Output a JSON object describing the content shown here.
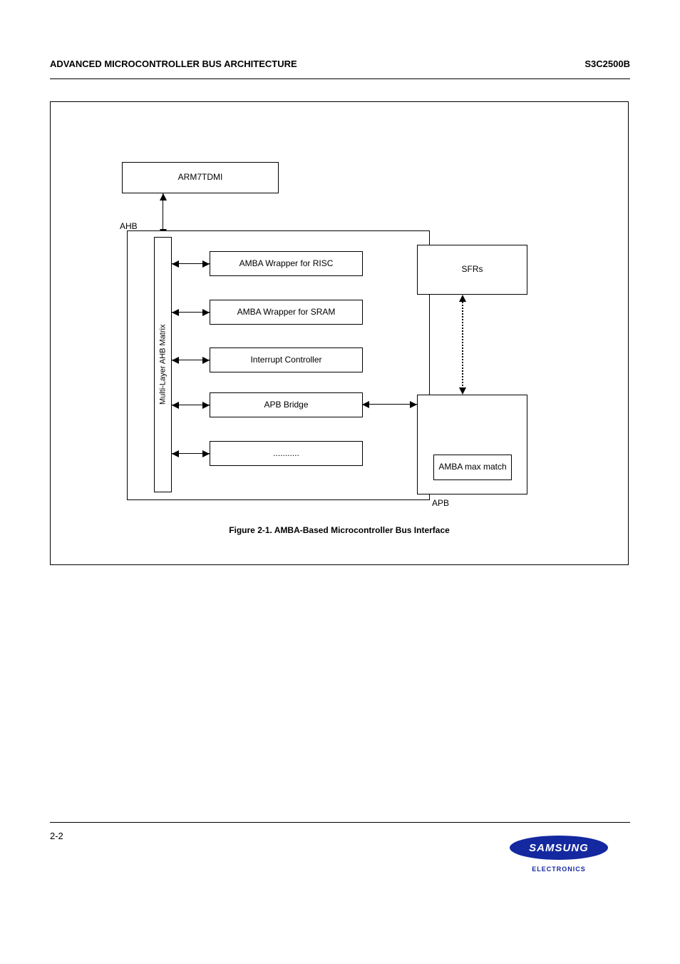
{
  "header": {
    "left": "ADVANCED MICROCONTROLLER BUS ARCHITECTURE",
    "right": "S3C2500B"
  },
  "diagram": {
    "arm7": "ARM7TDMI",
    "ahb": "AHB",
    "mlam": "Multi-Layer AHB Matrix",
    "risc": "AMBA Wrapper for RISC",
    "sram": "AMBA Wrapper for SRAM",
    "intc": "Interrupt Controller",
    "apb_bridge": "APB Bridge",
    "neg_box": "...........",
    "sfr": "SFRs",
    "apb": "APB",
    "max_match": "AMBA max match",
    "caption": "Figure 2-1. AMBA-Based Microcontroller Bus Interface"
  },
  "footer": {
    "page": "2-2",
    "logo": "SAMSUNG",
    "logo_sub": "ELECTRONICS"
  }
}
